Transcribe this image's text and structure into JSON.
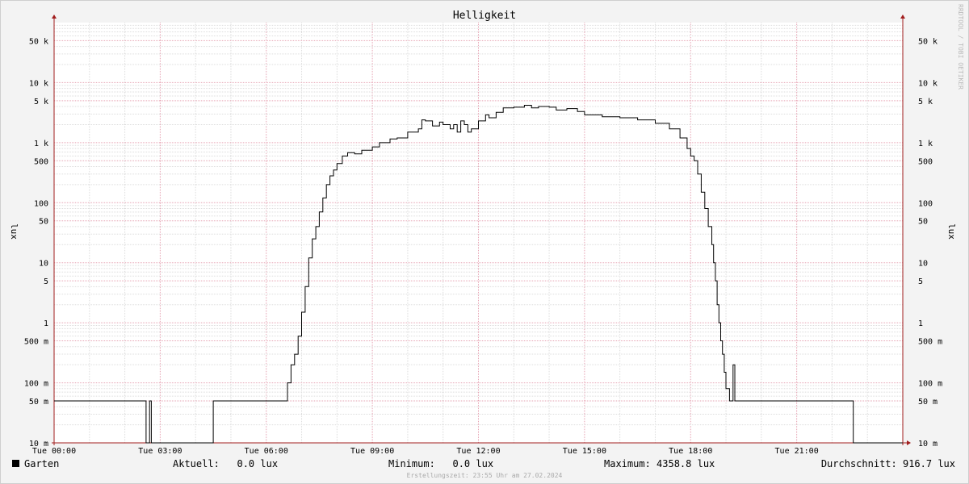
{
  "colors": {
    "background": "#f3f3f3",
    "canvas": "#ffffff",
    "grid_minor": "#dddddd",
    "grid_major": "#e6a3b3",
    "axis": "#a11d1d",
    "line": "#000000"
  },
  "chart_data": {
    "type": "line",
    "title": "Helligkeit",
    "ylabel": "lux",
    "yscale": "log",
    "ylim": [
      0.01,
      100000
    ],
    "xlim_hours": [
      0,
      24
    ],
    "grid": true,
    "x_ticks": [
      "Tue 00:00",
      "Tue 03:00",
      "Tue 06:00",
      "Tue 09:00",
      "Tue 12:00",
      "Tue 15:00",
      "Tue 18:00",
      "Tue 21:00"
    ],
    "y_ticks": [
      {
        "value": 0.01,
        "label": "10 m"
      },
      {
        "value": 0.05,
        "label": "50 m"
      },
      {
        "value": 0.1,
        "label": "100 m"
      },
      {
        "value": 0.5,
        "label": "500 m"
      },
      {
        "value": 1,
        "label": "1"
      },
      {
        "value": 5,
        "label": "5"
      },
      {
        "value": 10,
        "label": "10"
      },
      {
        "value": 50,
        "label": "50"
      },
      {
        "value": 100,
        "label": "100"
      },
      {
        "value": 500,
        "label": "500"
      },
      {
        "value": 1000,
        "label": "1 k"
      },
      {
        "value": 5000,
        "label": "5 k"
      },
      {
        "value": 10000,
        "label": "10 k"
      },
      {
        "value": 50000,
        "label": "50 k"
      }
    ],
    "series": [
      {
        "name": "Garten",
        "color": "#000000",
        "points": [
          [
            0.0,
            0.05
          ],
          [
            2.6,
            0.05
          ],
          [
            2.6,
            0.01
          ],
          [
            2.7,
            0.01
          ],
          [
            2.7,
            0.05
          ],
          [
            2.75,
            0.05
          ],
          [
            2.75,
            0.01
          ],
          [
            4.5,
            0.01
          ],
          [
            4.5,
            0.05
          ],
          [
            6.55,
            0.05
          ],
          [
            6.6,
            0.1
          ],
          [
            6.7,
            0.2
          ],
          [
            6.8,
            0.3
          ],
          [
            6.9,
            0.6
          ],
          [
            7.0,
            1.5
          ],
          [
            7.1,
            4
          ],
          [
            7.2,
            12
          ],
          [
            7.3,
            25
          ],
          [
            7.4,
            40
          ],
          [
            7.5,
            70
          ],
          [
            7.6,
            120
          ],
          [
            7.7,
            200
          ],
          [
            7.8,
            280
          ],
          [
            7.9,
            350
          ],
          [
            8.0,
            450
          ],
          [
            8.15,
            600
          ],
          [
            8.3,
            680
          ],
          [
            8.5,
            650
          ],
          [
            8.7,
            750
          ],
          [
            9.0,
            850
          ],
          [
            9.2,
            1000
          ],
          [
            9.5,
            1150
          ],
          [
            9.7,
            1200
          ],
          [
            10.0,
            1500
          ],
          [
            10.3,
            1700
          ],
          [
            10.4,
            2400
          ],
          [
            10.5,
            2300
          ],
          [
            10.7,
            1900
          ],
          [
            10.9,
            2200
          ],
          [
            11.0,
            2000
          ],
          [
            11.2,
            1700
          ],
          [
            11.3,
            2000
          ],
          [
            11.4,
            1500
          ],
          [
            11.5,
            2300
          ],
          [
            11.6,
            2000
          ],
          [
            11.7,
            1500
          ],
          [
            11.8,
            1700
          ],
          [
            12.0,
            2300
          ],
          [
            12.2,
            2900
          ],
          [
            12.3,
            2600
          ],
          [
            12.5,
            3200
          ],
          [
            12.7,
            3800
          ],
          [
            13.0,
            3900
          ],
          [
            13.3,
            4200
          ],
          [
            13.5,
            3800
          ],
          [
            13.7,
            4000
          ],
          [
            14.0,
            3900
          ],
          [
            14.2,
            3500
          ],
          [
            14.5,
            3700
          ],
          [
            14.8,
            3300
          ],
          [
            15.0,
            2900
          ],
          [
            15.5,
            2700
          ],
          [
            16.0,
            2600
          ],
          [
            16.5,
            2400
          ],
          [
            17.0,
            2100
          ],
          [
            17.4,
            1700
          ],
          [
            17.7,
            1200
          ],
          [
            17.9,
            800
          ],
          [
            18.0,
            600
          ],
          [
            18.1,
            500
          ],
          [
            18.2,
            300
          ],
          [
            18.3,
            150
          ],
          [
            18.4,
            80
          ],
          [
            18.5,
            40
          ],
          [
            18.6,
            20
          ],
          [
            18.65,
            10
          ],
          [
            18.7,
            5
          ],
          [
            18.75,
            2
          ],
          [
            18.8,
            1
          ],
          [
            18.85,
            0.5
          ],
          [
            18.9,
            0.3
          ],
          [
            18.95,
            0.15
          ],
          [
            19.0,
            0.08
          ],
          [
            19.1,
            0.05
          ],
          [
            19.2,
            0.05
          ],
          [
            19.2,
            0.2
          ],
          [
            19.25,
            0.2
          ],
          [
            19.25,
            0.05
          ],
          [
            22.6,
            0.05
          ],
          [
            22.6,
            0.01
          ],
          [
            24.0,
            0.01
          ]
        ]
      }
    ]
  },
  "footer": {
    "legend_name": "Garten",
    "current": "Aktuell:   0.0 lux",
    "minimum": "Minimum:   0.0 lux",
    "maximum": "Maximum: 4358.8 lux",
    "average": "Durchschnitt: 916.7 lux",
    "created": "Erstellungszeit: 23:55 Uhr am 27.02.2024"
  },
  "watermark": "RRDTOOL / TOBI OETIKER"
}
